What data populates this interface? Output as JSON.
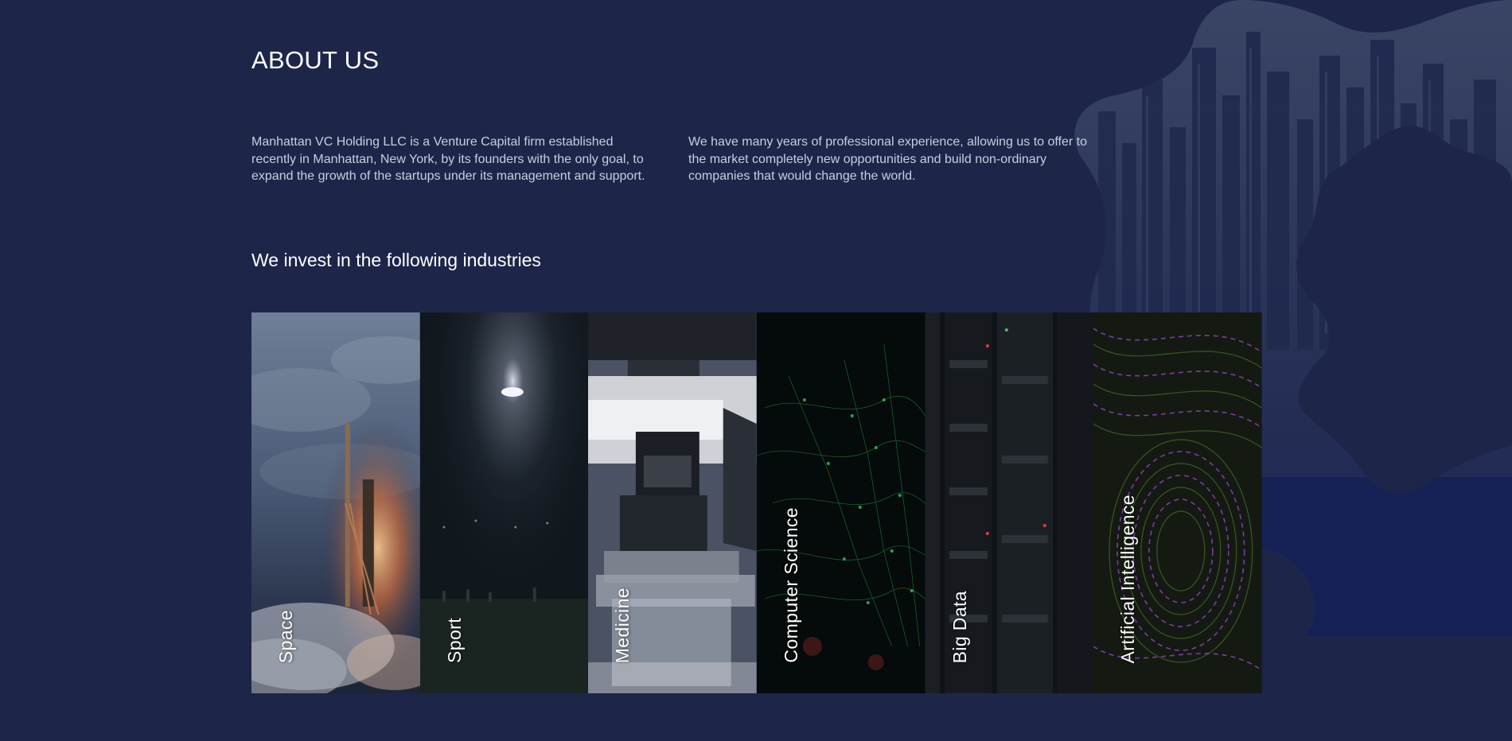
{
  "about": {
    "title": "ABOUT US",
    "paragraph_left": "Manhattan VC Holding LLC is a Venture Capital firm established recently in Manhattan, New York, by its founders with the only goal, to expand the growth of the startups under its management and support.",
    "paragraph_right": "We have many years of professional experience, allowing us to offer to the market completely new opportunities and build non-ordinary companies that would change the world."
  },
  "industries": {
    "title": "We invest in the following industries",
    "items": [
      {
        "label": "Space"
      },
      {
        "label": "Sport"
      },
      {
        "label": "Medicine"
      },
      {
        "label": "Computer Science"
      },
      {
        "label": "Big Data"
      },
      {
        "label": "Artificial Intelligence"
      }
    ]
  },
  "colors": {
    "background": "#1d2649",
    "text": "#ffffff",
    "muted_text": "#c9cede"
  }
}
